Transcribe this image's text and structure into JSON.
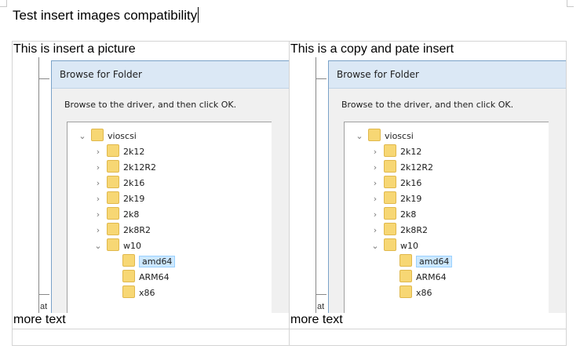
{
  "doc": {
    "title": "Test insert images compatibility",
    "table": {
      "left_caption": "This is insert a picture",
      "right_caption": "This is a copy and pate insert",
      "left_more": "more text",
      "right_more": "more text"
    }
  },
  "dialog": {
    "title": "Browse for Folder",
    "instruction": "Browse to the driver, and then click OK.",
    "tree": [
      {
        "label": "vioscsi",
        "level": 0,
        "expanded": true
      },
      {
        "label": "2k12",
        "level": 1,
        "expanded": false
      },
      {
        "label": "2k12R2",
        "level": 1,
        "expanded": false
      },
      {
        "label": "2k16",
        "level": 1,
        "expanded": false
      },
      {
        "label": "2k19",
        "level": 1,
        "expanded": false
      },
      {
        "label": "2k8",
        "level": 1,
        "expanded": false
      },
      {
        "label": "2k8R2",
        "level": 1,
        "expanded": false
      },
      {
        "label": "w10",
        "level": 1,
        "expanded": true
      },
      {
        "label": "amd64",
        "level": 2,
        "selected": true
      },
      {
        "label": "ARM64",
        "level": 2
      },
      {
        "label": "x86",
        "level": 2
      }
    ],
    "stray_label": "at"
  },
  "colors": {
    "title_bar": "#dbe8f5",
    "folder": "#f7d774",
    "selection": "#cce8ff",
    "table_border": "#d4d4d4"
  }
}
